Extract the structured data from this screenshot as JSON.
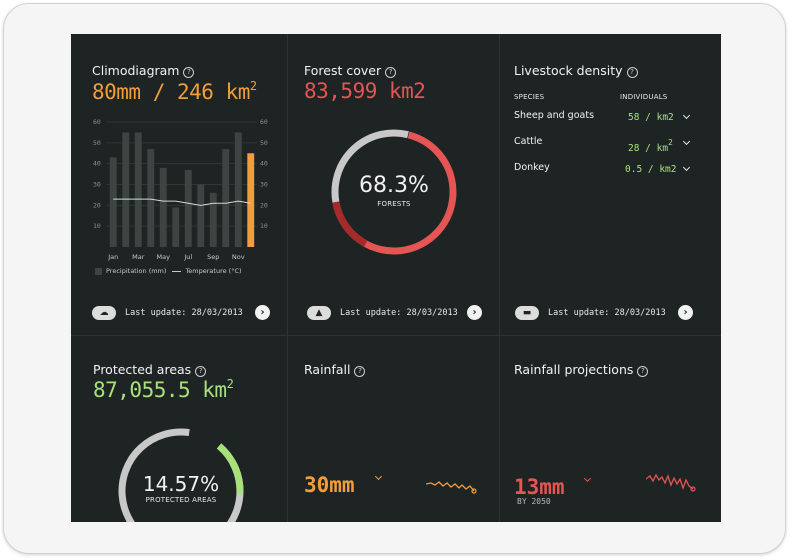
{
  "climodiagram": {
    "title": "Climodiagram",
    "value": "80mm / 246 km",
    "value_sup": "2",
    "left_axis": [
      "60",
      "50",
      "40",
      "30",
      "20",
      "10"
    ],
    "right_axis": [
      "60",
      "50",
      "40",
      "30",
      "20",
      "10"
    ],
    "months": [
      "Jan",
      "Mar",
      "May",
      "Jul",
      "Sep",
      "Nov"
    ],
    "precip_values": [
      43,
      55,
      55,
      47,
      38,
      19,
      37,
      30,
      26,
      47,
      55,
      45
    ],
    "temperature_values": [
      23,
      23,
      23,
      23,
      22,
      22,
      21,
      20,
      21,
      21,
      22,
      21
    ],
    "legend_precip": "Precipitation (mm)",
    "legend_temp": "Temperature (°C)",
    "last_update": "Last update: 28/03/2013",
    "colors": {
      "bar": "#3d4442",
      "highlight": "#f29d38",
      "line": "#d8d8d8"
    }
  },
  "forest_cover": {
    "title": "Forest cover",
    "value": "83,599 km2",
    "percent": "68.3%",
    "percent_fraction": 0.683,
    "sublabel": "FORESTS",
    "last_update": "Last update: 28/03/2013",
    "colors": {
      "main": "#e45554",
      "dark": "#a52a2a",
      "rest": "#c8c8c8"
    }
  },
  "livestock": {
    "title": "Livestock density",
    "col_species": "SPECIES",
    "col_individuals": "INDIVIDUALS",
    "rows": [
      {
        "species": "Sheep and goats",
        "value": "58 / km2"
      },
      {
        "species": "Cattle",
        "value": "28 / km",
        "sup": "2"
      },
      {
        "species": "Donkey",
        "value": "0.5 / km2"
      }
    ],
    "last_update": "Last update: 28/03/2013"
  },
  "protected": {
    "title": "Protected areas",
    "value": "87,055.5 km",
    "value_sup": "2",
    "percent": "14.57%",
    "percent_fraction": 0.1457,
    "sublabel": "PROTECTED AREAS",
    "colors": {
      "main": "#a8e07a",
      "rest": "#c8c8c8"
    }
  },
  "rainfall": {
    "title": "Rainfall",
    "value": "30mm",
    "color": "#f29d38"
  },
  "rainfall_projections": {
    "title": "Rainfall projections",
    "value": "13mm",
    "note": "BY 2050",
    "color": "#e45554"
  },
  "icons": {
    "help": "?",
    "weather": "☁",
    "forest": "▲",
    "livestock": "▬",
    "next": "›"
  }
}
